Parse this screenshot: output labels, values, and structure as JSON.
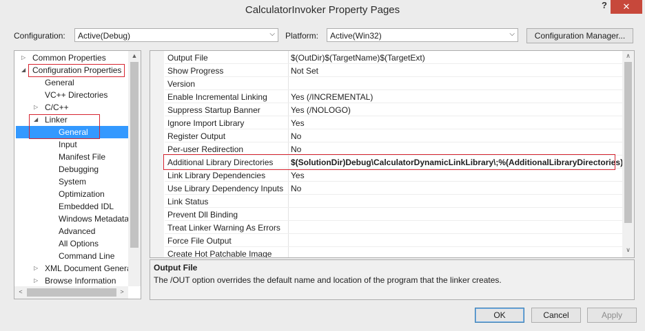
{
  "window": {
    "title": "CalculatorInvoker Property Pages",
    "help": "?",
    "close": "✕"
  },
  "config": {
    "configuration_label": "Configuration:",
    "configuration_value": "Active(Debug)",
    "platform_label": "Platform:",
    "platform_value": "Active(Win32)",
    "manager_button": "Configuration Manager..."
  },
  "tree": [
    {
      "label": "Common Properties",
      "toggle": "▷",
      "indent": 0
    },
    {
      "label": "Configuration Properties",
      "toggle": "◢",
      "indent": 0
    },
    {
      "label": "General",
      "toggle": "",
      "indent": 1
    },
    {
      "label": "VC++ Directories",
      "toggle": "",
      "indent": 1
    },
    {
      "label": "C/C++",
      "toggle": "▷",
      "indent": 1
    },
    {
      "label": "Linker",
      "toggle": "◢",
      "indent": 1
    },
    {
      "label": "General",
      "toggle": "",
      "indent": 2,
      "selected": true
    },
    {
      "label": "Input",
      "toggle": "",
      "indent": 2
    },
    {
      "label": "Manifest File",
      "toggle": "",
      "indent": 2
    },
    {
      "label": "Debugging",
      "toggle": "",
      "indent": 2
    },
    {
      "label": "System",
      "toggle": "",
      "indent": 2
    },
    {
      "label": "Optimization",
      "toggle": "",
      "indent": 2
    },
    {
      "label": "Embedded IDL",
      "toggle": "",
      "indent": 2
    },
    {
      "label": "Windows Metadata",
      "toggle": "",
      "indent": 2
    },
    {
      "label": "Advanced",
      "toggle": "",
      "indent": 2
    },
    {
      "label": "All Options",
      "toggle": "",
      "indent": 2
    },
    {
      "label": "Command Line",
      "toggle": "",
      "indent": 2
    },
    {
      "label": "XML Document Genera",
      "toggle": "▷",
      "indent": 1
    },
    {
      "label": "Browse Information",
      "toggle": "▷",
      "indent": 1
    }
  ],
  "properties": [
    {
      "name": "Output File",
      "value": "$(OutDir)$(TargetName)$(TargetExt)"
    },
    {
      "name": "Show Progress",
      "value": "Not Set"
    },
    {
      "name": "Version",
      "value": ""
    },
    {
      "name": "Enable Incremental Linking",
      "value": "Yes (/INCREMENTAL)"
    },
    {
      "name": "Suppress Startup Banner",
      "value": "Yes (/NOLOGO)"
    },
    {
      "name": "Ignore Import Library",
      "value": "Yes"
    },
    {
      "name": "Register Output",
      "value": "No"
    },
    {
      "name": "Per-user Redirection",
      "value": "No"
    },
    {
      "name": "Additional Library Directories",
      "value": "$(SolutionDir)Debug\\CalculatorDynamicLinkLibrary\\;%(AdditionalLibraryDirectories)",
      "bold": true
    },
    {
      "name": "Link Library Dependencies",
      "value": "Yes"
    },
    {
      "name": "Use Library Dependency Inputs",
      "value": "No"
    },
    {
      "name": "Link Status",
      "value": ""
    },
    {
      "name": "Prevent Dll Binding",
      "value": ""
    },
    {
      "name": "Treat Linker Warning As Errors",
      "value": ""
    },
    {
      "name": "Force File Output",
      "value": ""
    },
    {
      "name": "Create Hot Patchable Image",
      "value": ""
    }
  ],
  "description": {
    "title": "Output File",
    "text": "The /OUT option overrides the default name and location of the program that the linker creates."
  },
  "buttons": {
    "ok": "OK",
    "cancel": "Cancel",
    "apply": "Apply"
  },
  "colors": {
    "selection": "#3399ff",
    "highlight_box": "#d6222e",
    "close": "#c7483b"
  }
}
